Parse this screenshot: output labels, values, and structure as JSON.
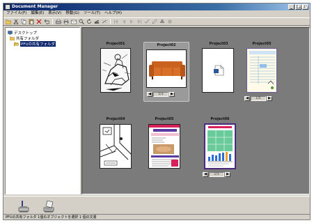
{
  "window": {
    "title": "Document Manager",
    "logo_text": "PFU"
  },
  "menu": {
    "items": [
      "ファイル(F)",
      "編集(E)",
      "表示(V)",
      "移動(G)",
      "ツール(T)",
      "ヘルプ(H)"
    ]
  },
  "tree": {
    "items": [
      {
        "label": "デスクトップ",
        "icon": "desktop-icon"
      },
      {
        "label": "共有フォルダ",
        "icon": "folder-icon"
      },
      {
        "label": "PFUの共有フォルダ",
        "icon": "open-folder-icon"
      }
    ]
  },
  "projects": [
    {
      "name": "Project01",
      "kind": "sketch-image",
      "page": ""
    },
    {
      "name": "Project02",
      "kind": "sofa-photo",
      "page": "1/3"
    },
    {
      "name": "Project03",
      "kind": "document-icon",
      "page": ""
    },
    {
      "name": "Project05",
      "kind": "form-document",
      "page": "1/5"
    },
    {
      "name": "Project04",
      "kind": "map-drawing",
      "page": ""
    },
    {
      "name": "Project05",
      "kind": "catalog-page",
      "page": ""
    },
    {
      "name": "Project06",
      "kind": "bar-chart-document",
      "page": "1/3"
    }
  ],
  "status": {
    "text": "PFUの共有フォルダ  1個のオブジェクトを選択  1 個の文書"
  },
  "colors": {
    "title_start": "#0a246a",
    "title_end": "#a6caf0",
    "content_bg": "#7b7b7b",
    "selection": "#0a246a"
  }
}
